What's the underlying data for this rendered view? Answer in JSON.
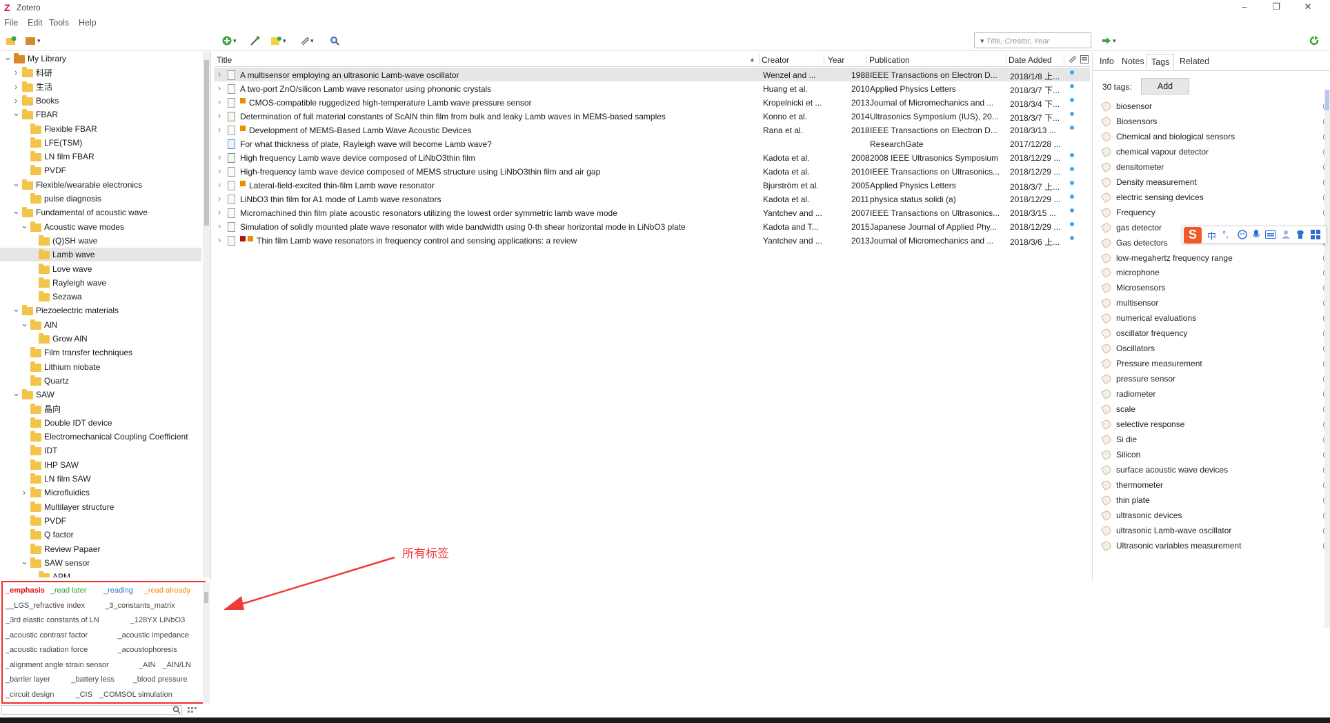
{
  "window": {
    "app_title": "Zotero",
    "minimize": "–",
    "maximize": "❐",
    "close": "✕"
  },
  "menu": [
    "File",
    "Edit",
    "Tools",
    "Help"
  ],
  "search": {
    "placeholder": "Title, Creator, Year"
  },
  "collections": [
    {
      "label": "My Library",
      "level": 0,
      "twisty": "open",
      "kind": "library"
    },
    {
      "label": "科研",
      "level": 1,
      "twisty": "closed"
    },
    {
      "label": "生活",
      "level": 1,
      "twisty": "closed"
    },
    {
      "label": "Books",
      "level": 1,
      "twisty": "closed"
    },
    {
      "label": "FBAR",
      "level": 1,
      "twisty": "open"
    },
    {
      "label": "Flexible FBAR",
      "level": 2,
      "twisty": "none"
    },
    {
      "label": "LFE(TSM)",
      "level": 2,
      "twisty": "none"
    },
    {
      "label": "LN film FBAR",
      "level": 2,
      "twisty": "none"
    },
    {
      "label": "PVDF",
      "level": 2,
      "twisty": "none"
    },
    {
      "label": "Flexible/wearable electronics",
      "level": 1,
      "twisty": "open"
    },
    {
      "label": "pulse diagnosis",
      "level": 2,
      "twisty": "none"
    },
    {
      "label": "Fundamental of acoustic wave",
      "level": 1,
      "twisty": "open"
    },
    {
      "label": "Acoustic wave modes",
      "level": 2,
      "twisty": "open"
    },
    {
      "label": "(Q)SH wave",
      "level": 3,
      "twisty": "none"
    },
    {
      "label": "Lamb wave",
      "level": 3,
      "twisty": "none",
      "selected": true
    },
    {
      "label": "Love wave",
      "level": 3,
      "twisty": "none"
    },
    {
      "label": "Rayleigh wave",
      "level": 3,
      "twisty": "none"
    },
    {
      "label": "Sezawa",
      "level": 3,
      "twisty": "none"
    },
    {
      "label": "Piezoelectric materials",
      "level": 1,
      "twisty": "open"
    },
    {
      "label": "AlN",
      "level": 2,
      "twisty": "open"
    },
    {
      "label": "Grow AlN",
      "level": 3,
      "twisty": "none"
    },
    {
      "label": "Film transfer techniques",
      "level": 2,
      "twisty": "none"
    },
    {
      "label": "Lithium niobate",
      "level": 2,
      "twisty": "none"
    },
    {
      "label": "Quartz",
      "level": 2,
      "twisty": "none"
    },
    {
      "label": "SAW",
      "level": 1,
      "twisty": "open"
    },
    {
      "label": "晶向",
      "level": 2,
      "twisty": "none"
    },
    {
      "label": "Double IDT device",
      "level": 2,
      "twisty": "none"
    },
    {
      "label": "Electromechanical Coupling Coefficient",
      "level": 2,
      "twisty": "none"
    },
    {
      "label": "IDT",
      "level": 2,
      "twisty": "none"
    },
    {
      "label": "IHP SAW",
      "level": 2,
      "twisty": "none"
    },
    {
      "label": "LN film SAW",
      "level": 2,
      "twisty": "none"
    },
    {
      "label": "Microfluidics",
      "level": 2,
      "twisty": "closed"
    },
    {
      "label": "Multilayer structure",
      "level": 2,
      "twisty": "none"
    },
    {
      "label": "PVDF",
      "level": 2,
      "twisty": "none"
    },
    {
      "label": "Q factor",
      "level": 2,
      "twisty": "none"
    },
    {
      "label": "Review Papaer",
      "level": 2,
      "twisty": "none"
    },
    {
      "label": "SAW sensor",
      "level": 2,
      "twisty": "open"
    },
    {
      "label": "APM",
      "level": 3,
      "twisty": "none"
    }
  ],
  "tag_selector": {
    "lines": [
      [
        {
          "text": "_emphasis",
          "color": "c1"
        },
        {
          "text": "_read later",
          "color": "c2"
        },
        {
          "text": "_reading",
          "color": "c3"
        },
        {
          "text": "_read already",
          "color": "c4"
        }
      ],
      [
        {
          "text": "__LGS_refractive index"
        },
        {
          "text": "_3_constants_matrix"
        }
      ],
      [
        {
          "text": "_3rd elastic constants of LN"
        },
        {
          "text": "_128YX LiNbO3"
        }
      ],
      [
        {
          "text": "_acoustic contrast factor"
        },
        {
          "text": "_acoustic impedance"
        }
      ],
      [
        {
          "text": "_acoustic radiation force"
        },
        {
          "text": "_acoustophoresis"
        }
      ],
      [
        {
          "text": "_alignment angle strain sensor"
        },
        {
          "text": "_AIN"
        },
        {
          "text": "_AIN/LN"
        }
      ],
      [
        {
          "text": "_barrier layer"
        },
        {
          "text": "_battery less"
        },
        {
          "text": "_blood pressure"
        }
      ],
      [
        {
          "text": "_circuit design"
        },
        {
          "text": "_CIS"
        },
        {
          "text": "_COMSOL simulation"
        }
      ]
    ]
  },
  "annotation": "所有标签",
  "item_columns": {
    "title": "Title",
    "creator": "Creator",
    "year": "Year",
    "publication": "Publication",
    "date_added": "Date Added"
  },
  "items": [
    {
      "title": "A multisensor employing an ultrasonic Lamb-wave oscillator",
      "creator": "Wenzel and ...",
      "year": "1988",
      "publication": "IEEE Transactions on Electron D...",
      "date": "2018/1/8 上...",
      "icon": "doc",
      "tags": [],
      "dot": true,
      "selected": true
    },
    {
      "title": "A two-port ZnO/silicon Lamb wave resonator using phononic crystals",
      "creator": "Huang et al.",
      "year": "2010",
      "publication": "Applied Physics Letters",
      "date": "2018/3/7 下...",
      "icon": "doc",
      "tags": [],
      "dot": true
    },
    {
      "title": "CMOS-compatible ruggedized high-temperature Lamb wave pressure sensor",
      "creator": "Kropelnicki et ...",
      "year": "2013",
      "publication": "Journal of Micromechanics and ...",
      "date": "2018/3/4 下...",
      "icon": "doc",
      "tags": [
        "#ee8c00"
      ],
      "dot": true
    },
    {
      "title": "Determination of full material constants of ScAlN thin film from bulk and leaky Lamb waves in MEMS-based samples",
      "creator": "Konno et al.",
      "year": "2014",
      "publication": "Ultrasonics Symposium (IUS), 20...",
      "date": "2018/3/7 下...",
      "icon": "img",
      "tags": [],
      "dot": true
    },
    {
      "title": "Development of MEMS-Based Lamb Wave Acoustic Devices",
      "creator": "Rana et al.",
      "year": "2018",
      "publication": "IEEE Transactions on Electron D...",
      "date": "2018/3/13 ...",
      "icon": "doc",
      "tags": [
        "#ee8c00"
      ],
      "dot": true
    },
    {
      "title": "For what thickness of plate, Rayleigh wave will become Lamb wave?",
      "creator": "",
      "year": "",
      "publication": "ResearchGate",
      "date": "2017/12/28 ...",
      "icon": "web",
      "tags": [],
      "dot": false,
      "no_twisty": true
    },
    {
      "title": "High frequency Lamb wave device composed of LiNbO3thin film",
      "creator": "Kadota et al.",
      "year": "2008",
      "publication": "2008 IEEE Ultrasonics Symposium",
      "date": "2018/12/29 ...",
      "icon": "img",
      "tags": [],
      "dot": true
    },
    {
      "title": "High-frequency lamb wave device composed of MEMS structure using LiNbO3thin film and air gap",
      "creator": "Kadota et al.",
      "year": "2010",
      "publication": "IEEE Transactions on Ultrasonics...",
      "date": "2018/12/29 ...",
      "icon": "doc",
      "tags": [],
      "dot": true
    },
    {
      "title": "Lateral-field-excited thin-film Lamb wave resonator",
      "creator": "Bjurström et al.",
      "year": "2005",
      "publication": "Applied Physics Letters",
      "date": "2018/3/7 上...",
      "icon": "doc",
      "tags": [
        "#ee8c00"
      ],
      "dot": true
    },
    {
      "title": "LiNbO3 thin film for A1 mode of Lamb wave resonators",
      "creator": "Kadota et al.",
      "year": "2011",
      "publication": "physica status solidi (a)",
      "date": "2018/12/29 ...",
      "icon": "doc",
      "tags": [],
      "dot": true
    },
    {
      "title": "Micromachined thin film plate acoustic resonators utilizing the lowest order symmetric lamb wave mode",
      "creator": "Yantchev and ...",
      "year": "2007",
      "publication": "IEEE Transactions on Ultrasonics...",
      "date": "2018/3/15 ...",
      "icon": "doc",
      "tags": [],
      "dot": true
    },
    {
      "title": "Simulation of solidly mounted plate wave resonator with wide bandwidth using 0-th shear horizontal mode in LiNbO3 plate",
      "creator": "Kadota and T...",
      "year": "2015",
      "publication": "Japanese Journal of Applied Phy...",
      "date": "2018/12/29 ...",
      "icon": "doc",
      "tags": [],
      "dot": true
    },
    {
      "title": "Thin film Lamb wave resonators in frequency control and sensing applications: a review",
      "creator": "Yantchev and ...",
      "year": "2013",
      "publication": "Journal of Micromechanics and ...",
      "date": "2018/3/6 上...",
      "icon": "doc",
      "tags": [
        "#b01515",
        "#ee8c00"
      ],
      "dot": true
    }
  ],
  "right_pane": {
    "tabs": [
      "Info",
      "Notes",
      "Tags",
      "Related"
    ],
    "active_tab": "Tags",
    "tag_count": "30 tags:",
    "add_label": "Add",
    "tags": [
      "biosensor",
      "Biosensors",
      "Chemical and biological sensors",
      "chemical vapour detector",
      "densitometer",
      "Density measurement",
      "electric sensing devices",
      "Frequency",
      "gas detector",
      "Gas detectors",
      "low-megahertz frequency range",
      "microphone",
      "Microsensors",
      "multisensor",
      "numerical evaluations",
      "oscillator frequency",
      "Oscillators",
      "Pressure measurement",
      "pressure sensor",
      "radiometer",
      "scale",
      "selective response",
      "Si die",
      "Silicon",
      "surface acoustic wave devices",
      "thermometer",
      "thin plate",
      "ultrasonic devices",
      "ultrasonic Lamb-wave oscillator",
      "Ultrasonic variables measurement"
    ]
  },
  "ime_bar": {
    "logo": "S",
    "mode": "中",
    "punct": "°,"
  }
}
